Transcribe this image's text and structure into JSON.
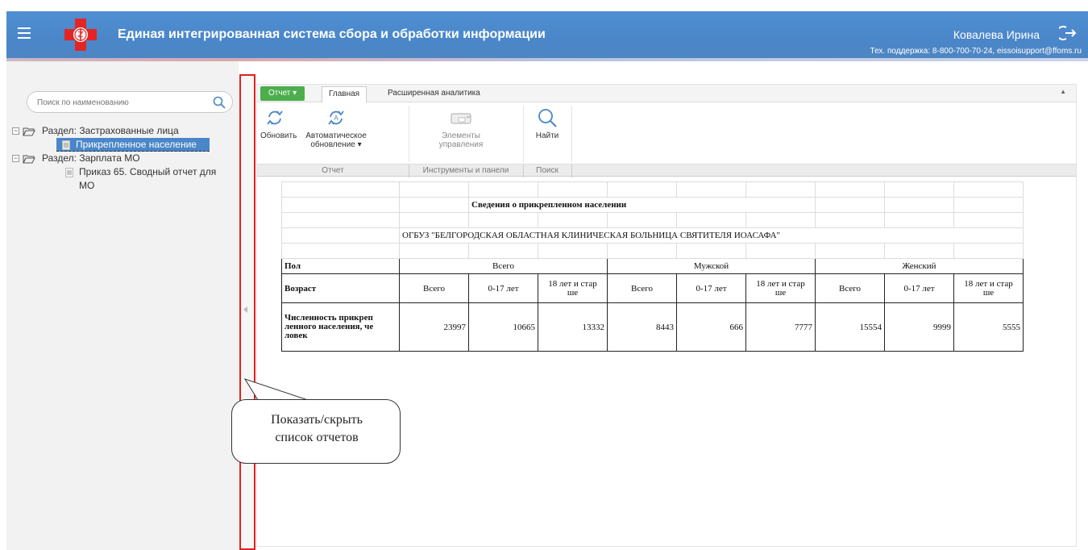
{
  "header": {
    "app_title": "Единая интегрированная система сбора и обработки информации",
    "user_name": "Ковалева Ирина",
    "support": "Тех. поддержка: 8-800-700-70-24, eissoisupport@ffoms.ru"
  },
  "sidebar": {
    "search_placeholder": "Поиск по наименованию",
    "tree": {
      "section1": "Раздел: Застрахованные лица",
      "section1_item": "Прикрепленное население",
      "section2": "Раздел: Зарплата МО",
      "section2_item_line1": "Приказ 65. Сводный отчет для",
      "section2_item_line2": "МО"
    }
  },
  "toolbar": {
    "report_tab": "Отчет",
    "tab_main": "Главная",
    "tab_analytics": "Расширенная аналитика",
    "refresh": "Обновить",
    "auto_refresh_line1": "Автоматическое",
    "auto_refresh_line2": "обновление ▾",
    "controls_line1": "Элементы",
    "controls_line2": "управления",
    "find": "Найти",
    "group_report": "Отчет",
    "group_tools": "Инструменты и панели",
    "group_search": "Поиск"
  },
  "report": {
    "title": "Сведения о прикрепленном населении",
    "org": "ОГБУЗ \"БЕЛГОРОДСКАЯ ОБЛАСТНАЯ КЛИНИЧЕСКАЯ БОЛЬНИЦА СВЯТИТЕЛЯ ИОАСАФА\"",
    "row_sex": "Пол",
    "row_age": "Возраст",
    "row_count_line1": "Численность прикреп",
    "row_count_line2": "ленного населения, че",
    "row_count_line3": "ловек",
    "group_total": "Всего",
    "group_male": "Мужской",
    "group_female": "Женский",
    "col_total": "Всего",
    "col_0_17": "0-17 лет",
    "col_18_line1": "18 лет и стар",
    "col_18_line2": "ше",
    "values": [
      "23997",
      "10665",
      "13332",
      "8443",
      "666",
      "7777",
      "15554",
      "9999",
      "5555"
    ]
  },
  "callout": {
    "line1": "Показать/скрыть",
    "line2": "список отчетов"
  },
  "colors": {
    "header": "#4a86c8",
    "report_tab": "#4cae4c",
    "selection": "#4a86c8",
    "splitter_border": "#e02020"
  }
}
